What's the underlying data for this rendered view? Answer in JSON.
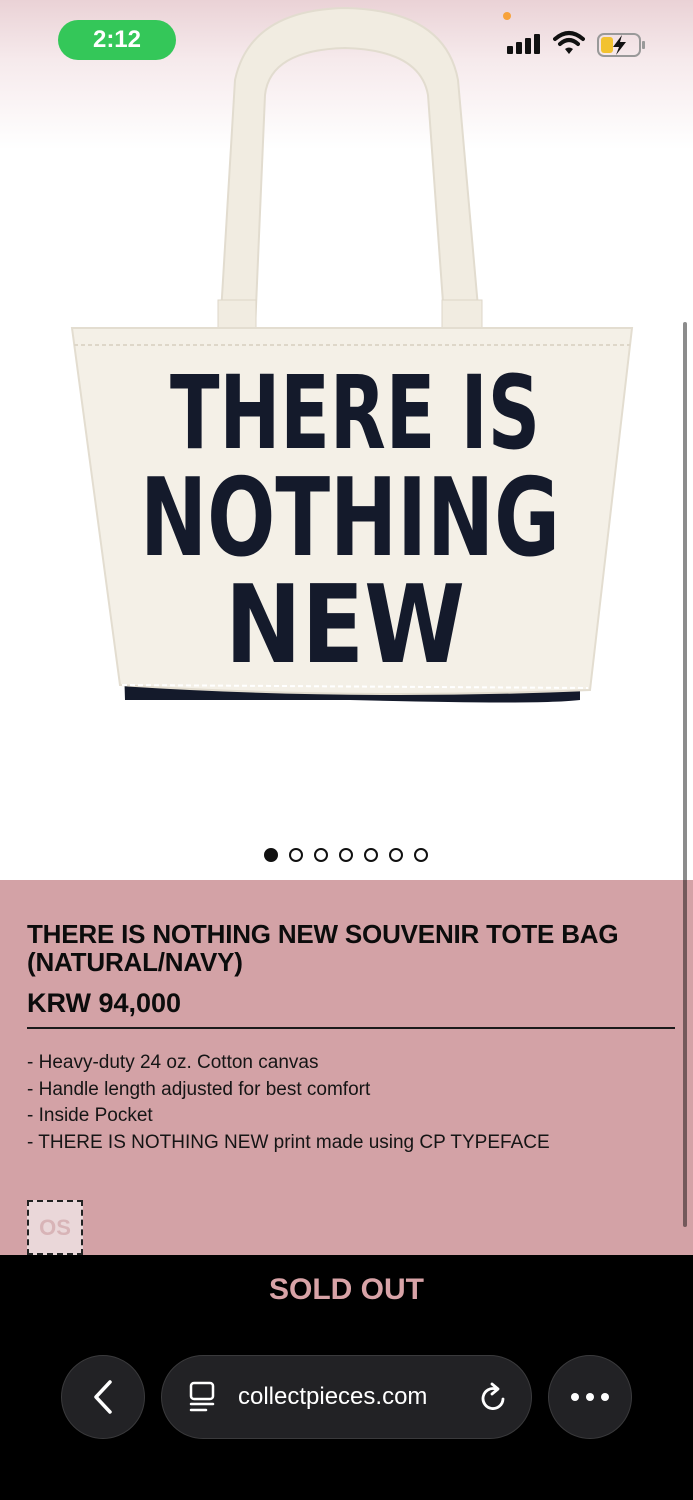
{
  "status_bar": {
    "time": "2:12"
  },
  "product": {
    "image_alt": "Natural canvas tote bag with navy print",
    "print_text": [
      "THERE IS",
      "NOTHING",
      "NEW"
    ],
    "carousel": {
      "total": 7,
      "active_index": 0
    },
    "title": "THERE IS NOTHING NEW SOUVENIR TOTE BAG (NATURAL/NAVY)",
    "price": "KRW 94,000",
    "description": [
      "- Heavy-duty 24 oz. Cotton canvas",
      "- Handle length adjusted for best comfort",
      "- Inside Pocket",
      "- THERE IS NOTHING NEW print made using CP TYPEFACE"
    ],
    "size_option": "OS",
    "cta_label": "SOLD OUT"
  },
  "browser": {
    "url": "collectpieces.com",
    "icons": [
      "back-icon",
      "tabs-icon",
      "reload-icon",
      "more-icon"
    ]
  },
  "colors": {
    "info_bg": "#d3a2a6",
    "sold_out": "#d8a3a7",
    "time_pill": "#34c759",
    "print_navy": "#141a2b"
  }
}
